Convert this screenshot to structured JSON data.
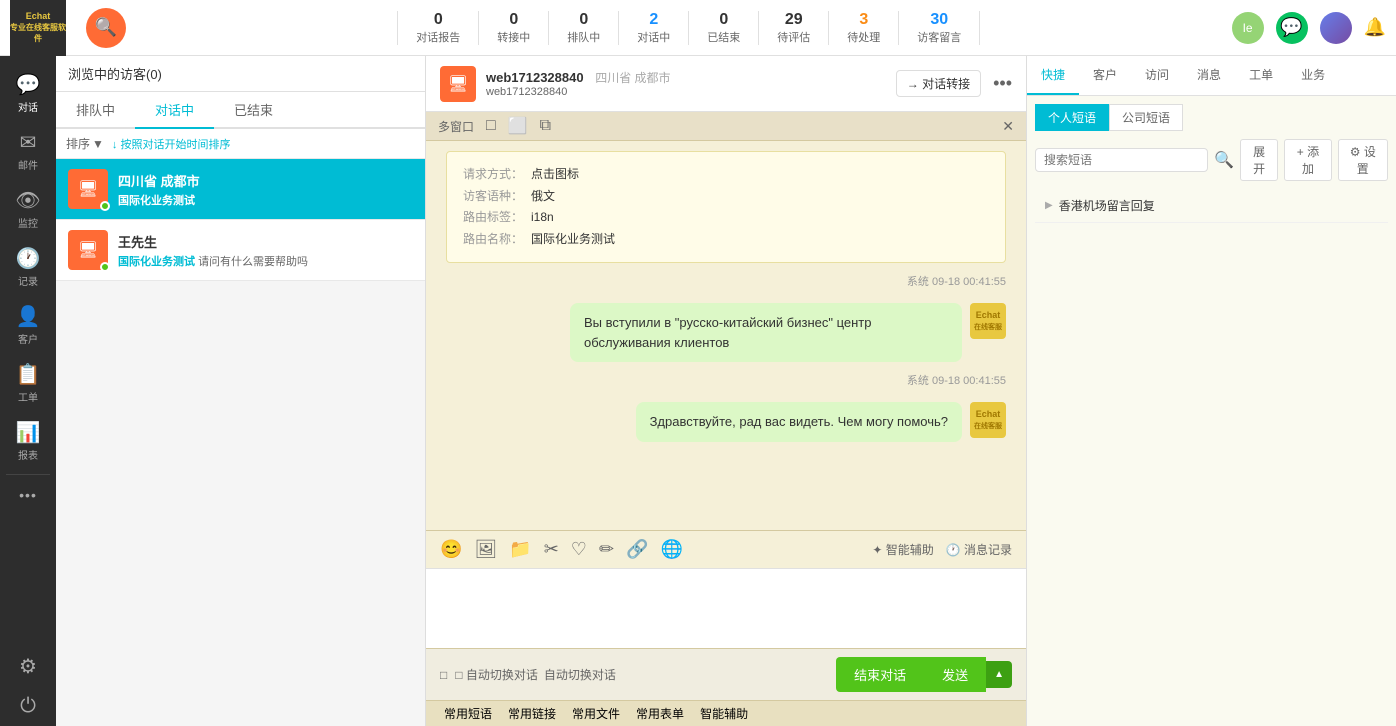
{
  "topbar": {
    "search_icon": "🔍",
    "stats": [
      {
        "id": "dialog-report",
        "num": "0",
        "label": "对话报告",
        "color": "normal"
      },
      {
        "id": "transfer",
        "num": "0",
        "label": "转接中",
        "color": "normal"
      },
      {
        "id": "queue",
        "num": "0",
        "label": "排队中",
        "color": "normal"
      },
      {
        "id": "active",
        "num": "2",
        "label": "对话中",
        "color": "blue"
      },
      {
        "id": "ended",
        "num": "0",
        "label": "已结束",
        "color": "normal"
      },
      {
        "id": "rating",
        "num": "29",
        "label": "待评估",
        "color": "normal"
      },
      {
        "id": "pending",
        "num": "3",
        "label": "待处理",
        "color": "orange"
      },
      {
        "id": "visitor-msg",
        "num": "30",
        "label": "访客留言",
        "color": "blue"
      }
    ]
  },
  "sidebar": {
    "items": [
      {
        "id": "dialog",
        "icon": "💬",
        "label": "对话",
        "active": true
      },
      {
        "id": "email",
        "icon": "✉",
        "label": "邮件",
        "active": false
      },
      {
        "id": "monitor",
        "icon": "👁",
        "label": "监控",
        "active": false
      },
      {
        "id": "history",
        "icon": "🕐",
        "label": "记录",
        "active": false
      },
      {
        "id": "customer",
        "icon": "👤",
        "label": "客户",
        "active": false
      },
      {
        "id": "workorder",
        "icon": "📋",
        "label": "工单",
        "active": false
      },
      {
        "id": "report",
        "icon": "📊",
        "label": "报表",
        "active": false
      },
      {
        "id": "more",
        "icon": "···",
        "label": "",
        "active": false
      },
      {
        "id": "settings",
        "icon": "⚙",
        "label": "",
        "active": false
      },
      {
        "id": "logout",
        "icon": "⏻",
        "label": "",
        "active": false
      }
    ]
  },
  "panel_left": {
    "header": "浏览中的访客(0)",
    "tabs": [
      {
        "id": "queue",
        "label": "排队中",
        "active": false
      },
      {
        "id": "active",
        "label": "对话中",
        "active": true
      },
      {
        "id": "ended",
        "label": "已结束",
        "active": false
      }
    ],
    "sort_label": "排序",
    "sort_time_label": "↓ 按照对话开始时间排序",
    "conversations": [
      {
        "id": "conv1",
        "name": "四川省 成都市",
        "tag": "国际化业务测试",
        "sub": "",
        "active": true,
        "icon": "🖥"
      },
      {
        "id": "conv2",
        "name": "王先生",
        "tag": "国际化业务测试",
        "sub": "请问有什么需要帮助吗",
        "active": false,
        "icon": "🖥"
      }
    ]
  },
  "chat": {
    "visitor_id": "web1712328840",
    "location": "四川省 成都市",
    "subtitle": "web1712328840",
    "transfer_label": "→ 对话转接",
    "multi_window_label": "多窗口",
    "toolbar_icons": [
      "😊",
      "🖼",
      "📁",
      "✂",
      "♡",
      "✏",
      "🔗",
      "🌐"
    ],
    "assist_label": "✦ 智能辅助",
    "history_label": "🕐 消息记录",
    "info_box": {
      "request_label": "请求方式：",
      "request_value": "点击图标",
      "lang_label": "访客语种：",
      "lang_value": "俄文",
      "route_tag_label": "路由标签：",
      "route_tag_value": "i18n",
      "route_name_label": "路由名称：",
      "route_name_value": "国际化业务测试"
    },
    "messages": [
      {
        "id": "msg1",
        "timestamp": "系统 09-18 00:41:55",
        "text": "Вы вступили в \"русско-китайский бизнес\" центр обслуживания клиентов",
        "side": "right",
        "avatar": "E"
      },
      {
        "id": "msg2",
        "timestamp": "系统 09-18 00:41:55",
        "text": "Здравствуйте, рад вас видеть. Чем могу помочь?",
        "side": "right",
        "avatar": "E"
      }
    ],
    "footer": {
      "auto_switch_label": "□ 自动切换对话",
      "end_label": "结束对话",
      "send_label": "发送",
      "quick_reply_label": "常用短语",
      "quick_link_label": "常用链接",
      "quick_file_label": "常用文件",
      "quick_form_label": "常用表单",
      "smart_assist_label": "智能辅助"
    }
  },
  "right_panel": {
    "tabs": [
      {
        "id": "quick",
        "label": "快捷",
        "active": true
      },
      {
        "id": "customer",
        "label": "客户",
        "active": false
      },
      {
        "id": "visit",
        "label": "访问",
        "active": false
      },
      {
        "id": "message",
        "label": "消息",
        "active": false
      },
      {
        "id": "workorder",
        "label": "工单",
        "active": false
      },
      {
        "id": "business",
        "label": "业务",
        "active": false
      }
    ],
    "quick_sub_tabs": [
      {
        "id": "personal",
        "label": "个人短语",
        "active": true
      },
      {
        "id": "company",
        "label": "公司短语",
        "active": false
      }
    ],
    "search_placeholder": "搜索短语",
    "action_btns": [
      {
        "id": "expand",
        "label": "展开"
      },
      {
        "id": "add",
        "label": "+ 添加"
      },
      {
        "id": "settings",
        "label": "⚙ 设置"
      }
    ],
    "quick_items": [
      {
        "id": "item1",
        "label": "香港机场留言回复"
      }
    ]
  }
}
